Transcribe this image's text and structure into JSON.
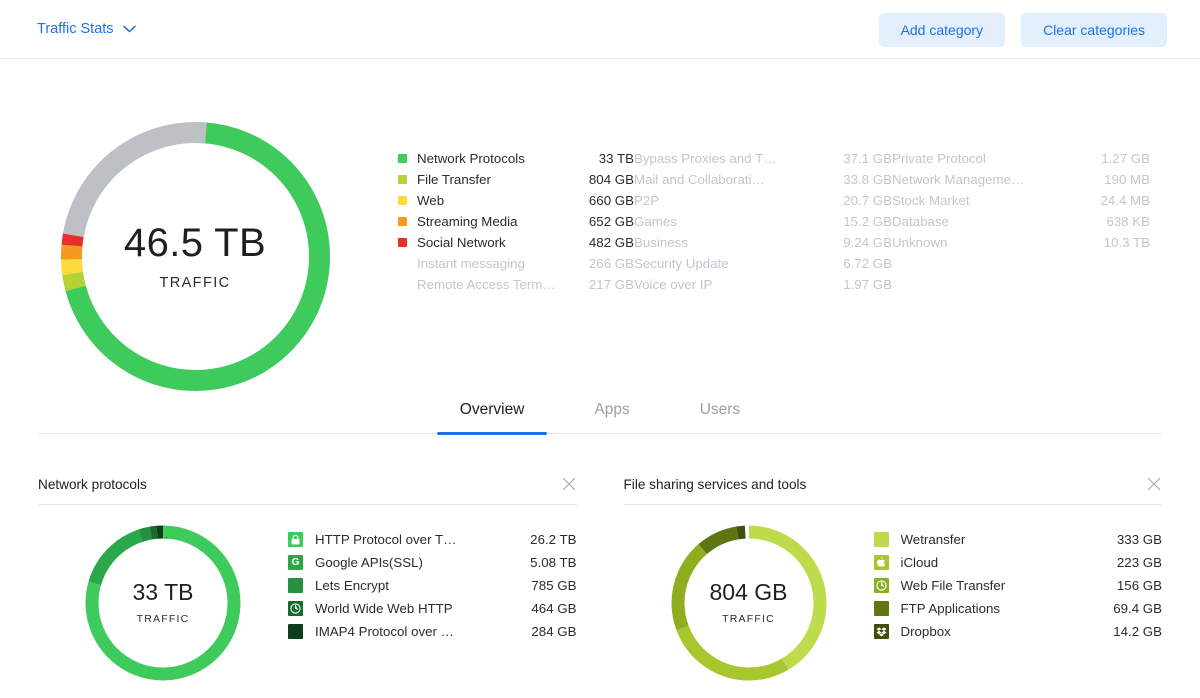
{
  "header": {
    "brand_label": "Traffic Stats",
    "caret_icon": "chevron-down-icon",
    "add_category_label": "Add category",
    "clear_categories_label": "Clear categories"
  },
  "hero": {
    "total_value": "46.5 TB",
    "total_label": "TRAFFIC"
  },
  "legend": {
    "col1": [
      {
        "label": "Network Protocols",
        "value": "33 TB",
        "color": "#3ecb5c",
        "dim": false
      },
      {
        "label": "File Transfer",
        "value": "804 GB",
        "color": "#b5d334",
        "dim": false
      },
      {
        "label": "Web",
        "value": "660 GB",
        "color": "#ffd83c",
        "dim": false
      },
      {
        "label": "Streaming Media",
        "value": "652 GB",
        "color": "#f29b1e",
        "dim": false
      },
      {
        "label": "Social Network",
        "value": "482 GB",
        "color": "#e8302b",
        "dim": false
      },
      {
        "label": "Instant messaging",
        "value": "266 GB",
        "color": "",
        "dim": true
      },
      {
        "label": "Remote Access Term…",
        "value": "217 GB",
        "color": "",
        "dim": true
      }
    ],
    "col2": [
      {
        "label": "Bypass Proxies and T…",
        "value": "37.1 GB",
        "dim": true
      },
      {
        "label": "Mail and Collaborati…",
        "value": "33.8 GB",
        "dim": true
      },
      {
        "label": "P2P",
        "value": "20.7 GB",
        "dim": true
      },
      {
        "label": "Games",
        "value": "15.2 GB",
        "dim": true
      },
      {
        "label": "Business",
        "value": "9.24 GB",
        "dim": true
      },
      {
        "label": "Security Update",
        "value": "6.72 GB",
        "dim": true
      },
      {
        "label": "Voice over IP",
        "value": "1.97 GB",
        "dim": true
      }
    ],
    "col3": [
      {
        "label": "Private Protocol",
        "value": "1.27 GB",
        "dim": true
      },
      {
        "label": "Network Manageme…",
        "value": "190 MB",
        "dim": true
      },
      {
        "label": "Stock Market",
        "value": "24.4 MB",
        "dim": true
      },
      {
        "label": "Database",
        "value": "638 KB",
        "dim": true
      },
      {
        "label": "Unknown",
        "value": "10.3 TB",
        "dim": true
      }
    ]
  },
  "tabs": [
    {
      "label": "Overview",
      "active": true
    },
    {
      "label": "Apps",
      "active": false
    },
    {
      "label": "Users",
      "active": false
    }
  ],
  "panels": [
    {
      "title": "Network protocols",
      "close_icon": "close-icon",
      "donut_value": "33 TB",
      "donut_label": "TRAFFIC",
      "items": [
        {
          "label": "HTTP Protocol over T…",
          "value": "26.2 TB",
          "color": "#3ecb5c",
          "icon": "lock-icon",
          "glyph": "▮"
        },
        {
          "label": "Google APIs(SSL)",
          "value": "5.08 TB",
          "color": "#2aa84a",
          "icon": "google-icon",
          "glyph": "G"
        },
        {
          "label": "Lets Encrypt",
          "value": "785 GB",
          "color": "#23913f",
          "icon": "square-icon",
          "glyph": ""
        },
        {
          "label": "World Wide Web HTTP",
          "value": "464 GB",
          "color": "#176b2c",
          "icon": "globe-icon",
          "glyph": "◔"
        },
        {
          "label": "IMAP4 Protocol over …",
          "value": "284 GB",
          "color": "#0d3d19",
          "icon": "square-icon",
          "glyph": ""
        }
      ]
    },
    {
      "title": "File sharing services and tools",
      "close_icon": "close-icon",
      "donut_value": "804 GB",
      "donut_label": "TRAFFIC",
      "items": [
        {
          "label": "Wetransfer",
          "value": "333 GB",
          "color": "#bedb4b",
          "icon": "square-icon",
          "glyph": ""
        },
        {
          "label": "iCloud",
          "value": "223 GB",
          "color": "#a8c72e",
          "icon": "apple-icon",
          "glyph": "❦"
        },
        {
          "label": "Web File Transfer",
          "value": "156 GB",
          "color": "#8fae1f",
          "icon": "globe-icon",
          "glyph": "◔"
        },
        {
          "label": "FTP Applications",
          "value": "69.4 GB",
          "color": "#5d7512",
          "icon": "square-icon",
          "glyph": ""
        },
        {
          "label": "Dropbox",
          "value": "14.2 GB",
          "color": "#3f4f0b",
          "icon": "dropbox-icon",
          "glyph": "❖"
        }
      ]
    }
  ],
  "chart_data": [
    {
      "type": "pie",
      "title": "46.5 TB TRAFFIC",
      "center_value": "46.5 TB",
      "center_label": "TRAFFIC",
      "categories": [
        "Network Protocols",
        "File Transfer",
        "Web",
        "Streaming Media",
        "Social Network",
        "Other / Unknown"
      ],
      "values": [
        33,
        0.804,
        0.66,
        0.652,
        0.482,
        10.9
      ],
      "unit": "TB",
      "colors": [
        "#3ecb5c",
        "#b5d334",
        "#ffd83c",
        "#f29b1e",
        "#e8302b",
        "#bdc1c6"
      ],
      "legend_position": "right",
      "donut": true
    },
    {
      "type": "pie",
      "title": "Network protocols",
      "center_value": "33 TB",
      "center_label": "TRAFFIC",
      "categories": [
        "HTTP Protocol over T…",
        "Google APIs(SSL)",
        "Lets Encrypt",
        "World Wide Web HTTP",
        "IMAP4 Protocol over …"
      ],
      "values": [
        26.2,
        5.08,
        0.785,
        0.464,
        0.284
      ],
      "unit": "TB",
      "colors": [
        "#3ecb5c",
        "#2aa84a",
        "#23913f",
        "#176b2c",
        "#0d3d19"
      ],
      "legend_position": "right",
      "donut": true
    },
    {
      "type": "pie",
      "title": "File sharing services and tools",
      "center_value": "804 GB",
      "center_label": "TRAFFIC",
      "categories": [
        "Wetransfer",
        "iCloud",
        "Web File Transfer",
        "FTP Applications",
        "Dropbox"
      ],
      "values": [
        333,
        223,
        156,
        69.4,
        14.2
      ],
      "unit": "GB",
      "colors": [
        "#bedb4b",
        "#a8c72e",
        "#8fae1f",
        "#5d7512",
        "#3f4f0b"
      ],
      "legend_position": "right",
      "donut": true
    }
  ]
}
